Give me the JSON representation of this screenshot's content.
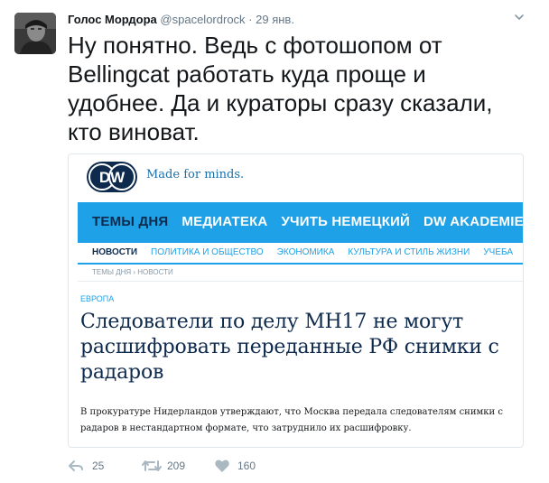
{
  "tweet": {
    "author_name": "Голос Мордора",
    "author_handle": "@spacelordrock",
    "separator": "·",
    "time": "29 янв.",
    "text": "Ну понятно. Ведь с фотошопом от Bellingcat работать куда проще и удобнее. Да и кураторы сразу сказали, кто виноват."
  },
  "card": {
    "logo_text": "DW",
    "slogan": "Made for minds.",
    "nav_main": [
      "ТЕМЫ ДНЯ",
      "МЕДИАТЕКА",
      "УЧИТЬ НЕМЕЦКИЙ",
      "DW AKADEMIE"
    ],
    "nav_sub": [
      "НОВОСТИ",
      "ПОЛИТИКА И ОБЩЕСТВО",
      "ЭКОНОМИКА",
      "КУЛЬТУРА И СТИЛЬ ЖИЗНИ",
      "УЧЕБА"
    ],
    "breadcrumb": "ТЕМЫ ДНЯ › НОВОСТИ",
    "section": "ЕВРОПА",
    "headline": "Следователи по делу МН17 не могут расшифровать переданные РФ снимки с радаров",
    "lead": "В прокуратуре Нидерландов утверждают, что Москва передала следователям снимки с радаров в нестандартном формате, что затруднило их расшифровку."
  },
  "actions": {
    "reply_count": "25",
    "retweet_count": "209",
    "like_count": "160"
  },
  "colors": {
    "dw_blue": "#1ea1e6",
    "dw_navy": "#0e2a4d",
    "muted": "#657786",
    "text": "#14171a"
  }
}
